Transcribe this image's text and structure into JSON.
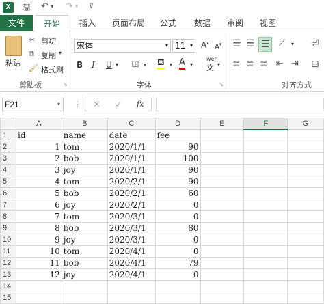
{
  "qat": {
    "excel_icon": "X",
    "save_icon": "save-icon",
    "undo_icon": "undo-icon",
    "redo_icon": "redo-icon"
  },
  "tabs": [
    "文件",
    "开始",
    "插入",
    "页面布局",
    "公式",
    "数据",
    "审阅",
    "视图"
  ],
  "ribbon": {
    "clipboard": {
      "paste": "粘贴",
      "cut": "剪切",
      "copy": "复制",
      "format_painter": "格式刷",
      "label": "剪贴板"
    },
    "font": {
      "name": "宋体",
      "size": "11",
      "label": "字体",
      "bold": "B",
      "italic": "I",
      "underline": "U",
      "wen": "wén",
      "wen2": "文"
    },
    "align": {
      "label": "对齐方式"
    }
  },
  "formula": {
    "namebox": "F21",
    "fx": "fx"
  },
  "columns": [
    "A",
    "B",
    "C",
    "D",
    "E",
    "F",
    "G"
  ],
  "rows": [
    [
      "1",
      "id",
      "name",
      "date",
      "fee",
      "",
      ""
    ],
    [
      "2",
      "1",
      "tom",
      "2020/1/1",
      "90",
      "",
      ""
    ],
    [
      "3",
      "2",
      "bob",
      "2020/1/1",
      "100",
      "",
      ""
    ],
    [
      "4",
      "3",
      "joy",
      "2020/1/1",
      "90",
      "",
      ""
    ],
    [
      "5",
      "4",
      "tom",
      "2020/2/1",
      "90",
      "",
      ""
    ],
    [
      "6",
      "5",
      "bob",
      "2020/2/1",
      "60",
      "",
      ""
    ],
    [
      "7",
      "6",
      "joy",
      "2020/2/1",
      "0",
      "",
      ""
    ],
    [
      "8",
      "7",
      "tom",
      "2020/3/1",
      "0",
      "",
      ""
    ],
    [
      "9",
      "8",
      "bob",
      "2020/3/1",
      "80",
      "",
      ""
    ],
    [
      "10",
      "9",
      "joy",
      "2020/3/1",
      "0",
      "",
      ""
    ],
    [
      "11",
      "10",
      "tom",
      "2020/4/1",
      "0",
      "",
      ""
    ],
    [
      "12",
      "11",
      "bob",
      "2020/4/1",
      "79",
      "",
      ""
    ],
    [
      "13",
      "12",
      "joy",
      "2020/4/1",
      "0",
      "",
      ""
    ],
    [
      "14",
      "",
      "",
      "",
      "",
      "",
      ""
    ],
    [
      "15",
      "",
      "",
      "",
      "",
      "",
      ""
    ]
  ],
  "colors": {
    "accent": "#217346"
  }
}
